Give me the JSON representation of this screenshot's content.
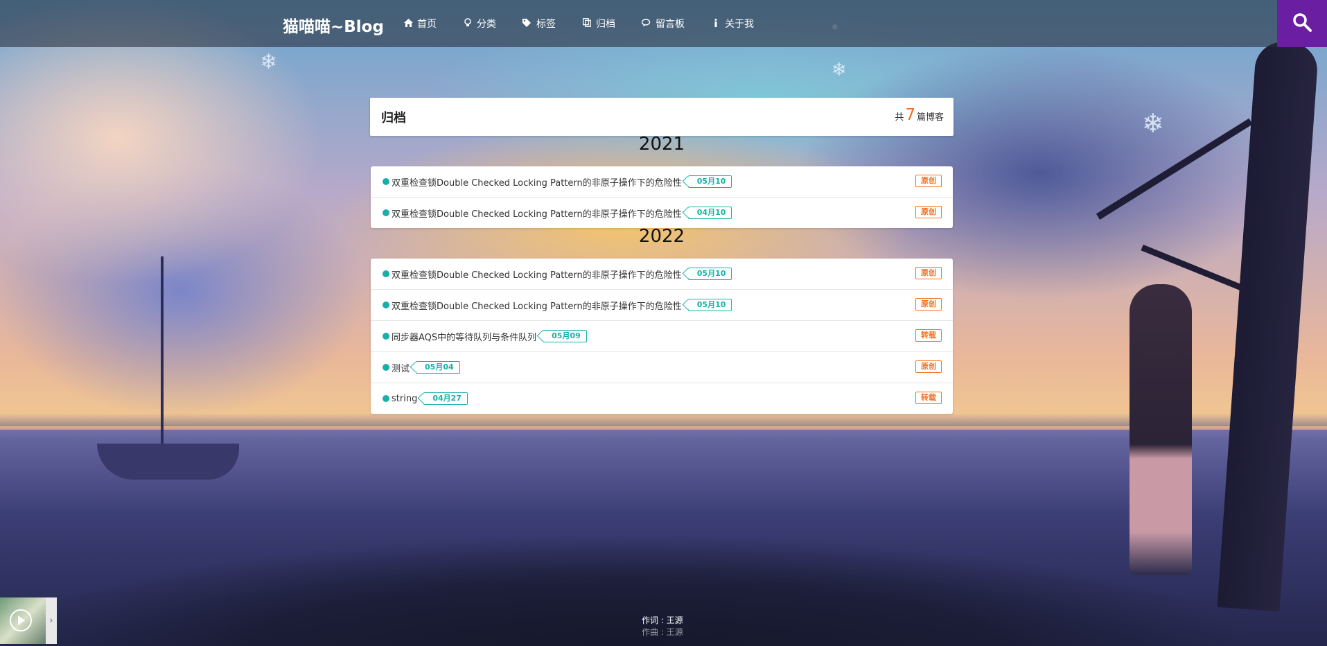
{
  "header": {
    "brand": "猫喵喵~Blog",
    "nav": [
      {
        "label": "首页",
        "icon": "home-icon"
      },
      {
        "label": "分类",
        "icon": "lightbulb-icon"
      },
      {
        "label": "标签",
        "icon": "tags-icon"
      },
      {
        "label": "归档",
        "icon": "copy-icon"
      },
      {
        "label": "留言板",
        "icon": "comments-icon"
      },
      {
        "label": "关于我",
        "icon": "info-icon"
      }
    ],
    "search_icon": "search-icon",
    "search_bg": "#6a1ea1"
  },
  "archive": {
    "title": "归档",
    "count_prefix": "共",
    "count": "7",
    "count_suffix": "篇博客"
  },
  "years": [
    {
      "year": "2021",
      "posts": [
        {
          "title": "双重检查锁Double Checked Locking Pattern的非原子操作下的危险性",
          "date": "05月10",
          "tag": "原创"
        },
        {
          "title": "双重检查锁Double Checked Locking Pattern的非原子操作下的危险性",
          "date": "04月10",
          "tag": "原创"
        }
      ]
    },
    {
      "year": "2022",
      "posts": [
        {
          "title": "双重检查锁Double Checked Locking Pattern的非原子操作下的危险性",
          "date": "05月10",
          "tag": "原创"
        },
        {
          "title": "双重检查锁Double Checked Locking Pattern的非原子操作下的危险性",
          "date": "05月10",
          "tag": "原创"
        },
        {
          "title": "同步器AQS中的等待队列与条件队列",
          "date": "05月09",
          "tag": "转载"
        },
        {
          "title": "测试",
          "date": "05月04",
          "tag": "原创"
        },
        {
          "title": "string",
          "date": "04月27",
          "tag": "转载"
        }
      ]
    }
  ],
  "player": {
    "lyric_line1": "作词 : 王源",
    "lyric_line2": "作曲 : 王源"
  },
  "colors": {
    "accent_teal": "#17b0a8",
    "accent_orange": "#f2711c"
  }
}
